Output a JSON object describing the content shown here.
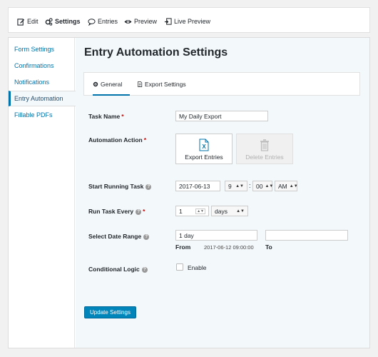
{
  "toolbar": {
    "items": [
      {
        "label": "Edit",
        "icon": "edit-icon"
      },
      {
        "label": "Settings",
        "icon": "gears-icon",
        "active": true
      },
      {
        "label": "Entries",
        "icon": "comment-icon"
      },
      {
        "label": "Preview",
        "icon": "eye-icon"
      },
      {
        "label": "Live Preview",
        "icon": "external-link-icon"
      }
    ]
  },
  "sidebar": {
    "items": [
      {
        "label": "Form Settings"
      },
      {
        "label": "Confirmations"
      },
      {
        "label": "Notifications"
      },
      {
        "label": "Entry Automation",
        "active": true
      },
      {
        "label": "Fillable PDFs"
      }
    ]
  },
  "page": {
    "title": "Entry Automation Settings"
  },
  "tabs": [
    {
      "label": "General",
      "icon": "gear-icon",
      "active": true
    },
    {
      "label": "Export Settings",
      "icon": "file-icon"
    }
  ],
  "form": {
    "task_name": {
      "label": "Task Name",
      "required": "*",
      "value": "My Daily Export"
    },
    "automation_action": {
      "label": "Automation Action",
      "required": "*",
      "options": [
        {
          "label": "Export Entries",
          "icon": "excel-icon",
          "selected": true
        },
        {
          "label": "Delete Entries",
          "icon": "trash-icon",
          "disabled": true
        }
      ]
    },
    "start_running": {
      "label": "Start Running Task",
      "date": "2017-06-13",
      "hour": "9",
      "separator": ":",
      "minute": "00",
      "ampm": "AM"
    },
    "run_every": {
      "label": "Run Task Every",
      "required": "*",
      "value": "1",
      "unit": "days"
    },
    "date_range": {
      "label": "Select Date Range",
      "from_value": "1 day",
      "to_value": "",
      "from_label": "From",
      "from_computed": "2017-06-12 09:00:00",
      "to_label": "To"
    },
    "conditional_logic": {
      "label": "Conditional Logic",
      "checkbox_label": "Enable",
      "checked": false
    },
    "help_glyph": "?",
    "submit_label": "Update Settings"
  },
  "colors": {
    "accent": "#0073aa",
    "button": "#0085ba",
    "required": "#cc0000",
    "content_bg": "#f3f8fb"
  }
}
